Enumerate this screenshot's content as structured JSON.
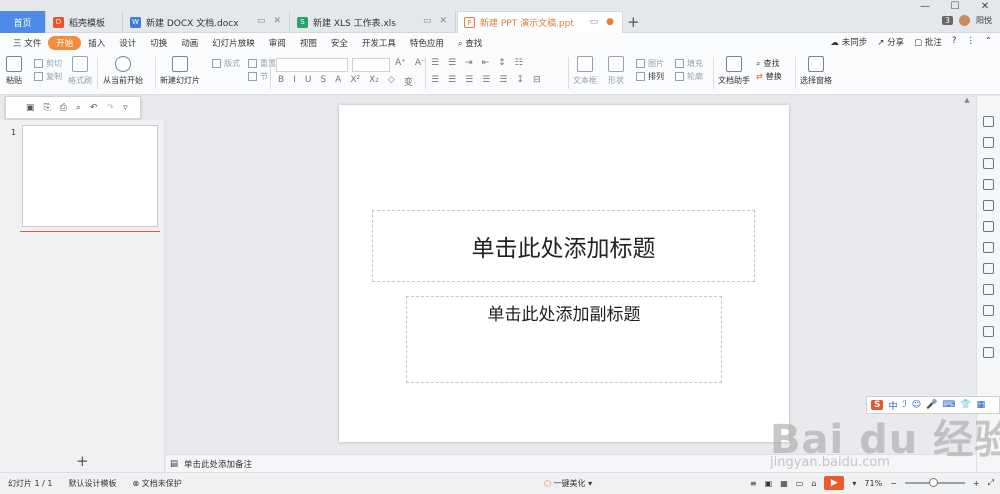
{
  "tabs": {
    "home": "首页",
    "items": [
      {
        "label": "稻壳模板",
        "icon_color": "#e8542d"
      },
      {
        "label": "新建 DOCX 文档.docx",
        "icon_color": "#3b7ddd"
      },
      {
        "label": "新建 XLS 工作表.xls",
        "icon_color": "#2aa36a"
      },
      {
        "label": "新建 PPT 演示文稿.ppt",
        "icon_color": "#ec7a3a"
      }
    ],
    "new_tab": "+"
  },
  "titlebar": {
    "count": "3",
    "user": "阳悦"
  },
  "menu": {
    "file": "三 文件",
    "items": [
      "开始",
      "插入",
      "设计",
      "切换",
      "动画",
      "幻灯片放映",
      "审阅",
      "视图",
      "安全",
      "开发工具",
      "特色应用"
    ],
    "search": "查找",
    "sync": "未同步",
    "share": "分享",
    "comment": "批注"
  },
  "ribbon": {
    "paste": "粘贴",
    "cut": "剪切",
    "copy": "复制",
    "format_painter": "格式刷",
    "from_current": "从当前开始",
    "new_slide": "新建幻灯片",
    "layout": "版式",
    "section": "节",
    "reset": "重置",
    "text_box": "文本框",
    "shape": "形状",
    "arrange": "排列",
    "picture": "图片",
    "fill": "填充",
    "outline": "轮廓",
    "doc_assist": "文档助手",
    "find": "查找",
    "replace": "替换",
    "select_pane": "选择窗格"
  },
  "slide": {
    "number": "1",
    "title_placeholder": "单击此处添加标题",
    "subtitle_placeholder": "单击此处添加副标题"
  },
  "notes": {
    "placeholder": "单击此处添加备注"
  },
  "status": {
    "slide_count": "幻灯片 1 / 1",
    "template": "默认设计模板",
    "protection": "文档未保护",
    "beautify": "一键美化",
    "zoom": "71%"
  },
  "ime": {
    "logo": "S",
    "lang": "中"
  },
  "watermark": {
    "brand": "Bai du 经验",
    "url": "jingyan.baidu.com"
  },
  "colors": {
    "accent": "#f28d3b",
    "home_tab": "#4e8be8",
    "play": "#ed5a2a"
  }
}
